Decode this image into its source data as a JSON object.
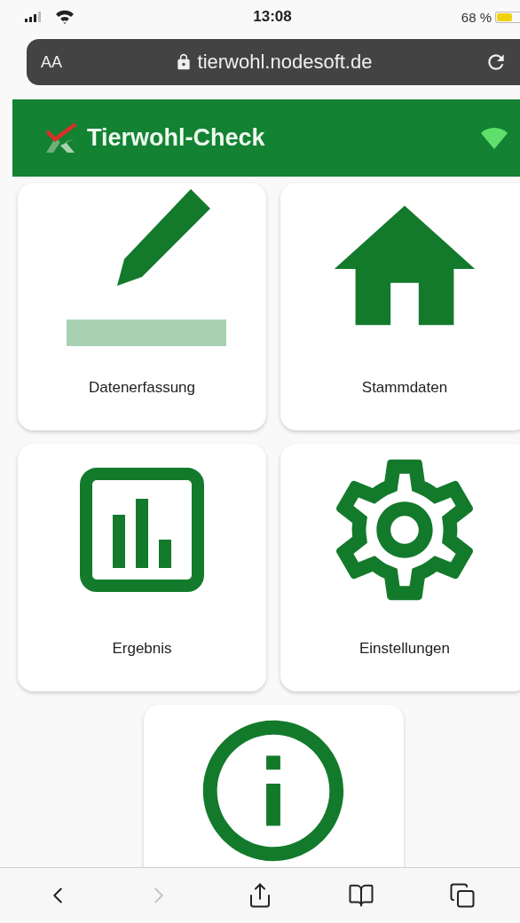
{
  "status_bar": {
    "time": "13:08",
    "battery": "68 %"
  },
  "address_bar": {
    "text_size": "AA",
    "url": "tierwohl.nodesoft.de"
  },
  "header": {
    "title": "Tierwohl-Check",
    "online": true
  },
  "tiles": [
    {
      "kind": "edit",
      "label": "Datenerfassung"
    },
    {
      "kind": "home",
      "label": "Stammdaten"
    },
    {
      "kind": "chart",
      "label": "Ergebnis"
    },
    {
      "kind": "settings",
      "label": "Einstellungen"
    },
    {
      "kind": "info"
    }
  ],
  "toolbar": [
    {
      "kind": "back",
      "disabled": false
    },
    {
      "kind": "forward",
      "disabled": true
    },
    {
      "kind": "share",
      "disabled": false
    },
    {
      "kind": "bookmarks",
      "disabled": false
    },
    {
      "kind": "tabs",
      "disabled": false
    }
  ]
}
